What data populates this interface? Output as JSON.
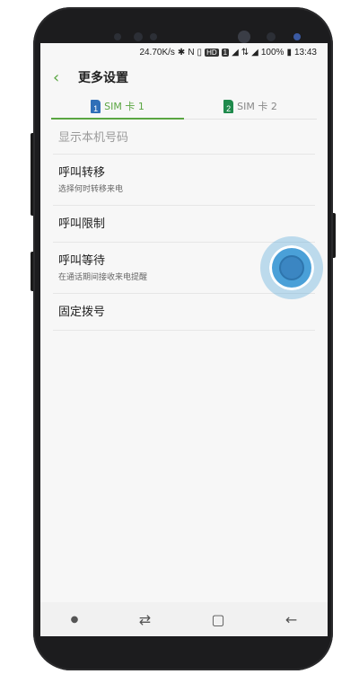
{
  "status_bar": {
    "net_speed": "24.70K/s",
    "badge_hd": "HD",
    "badge_1": "1",
    "battery": "100%",
    "time": "13:43"
  },
  "header": {
    "back_icon": "back-arrow-icon",
    "title": "更多设置"
  },
  "tabs": [
    {
      "sim_number": "1",
      "label": "SIM 卡 1",
      "active": true
    },
    {
      "sim_number": "2",
      "label": "SIM 卡 2",
      "active": false
    }
  ],
  "settings": {
    "show_number": {
      "title": "显示本机号码"
    },
    "call_forwarding": {
      "title": "呼叫转移",
      "subtitle": "选择何时转移来电"
    },
    "call_barring": {
      "title": "呼叫限制"
    },
    "call_waiting": {
      "title": "呼叫等待",
      "subtitle": "在通话期间接收来电提醒",
      "enabled": false
    },
    "fixed_dialing": {
      "title": "固定拨号"
    }
  },
  "colors": {
    "accent": "#5aa642",
    "toggle_highlight": "#4aa0d8"
  }
}
